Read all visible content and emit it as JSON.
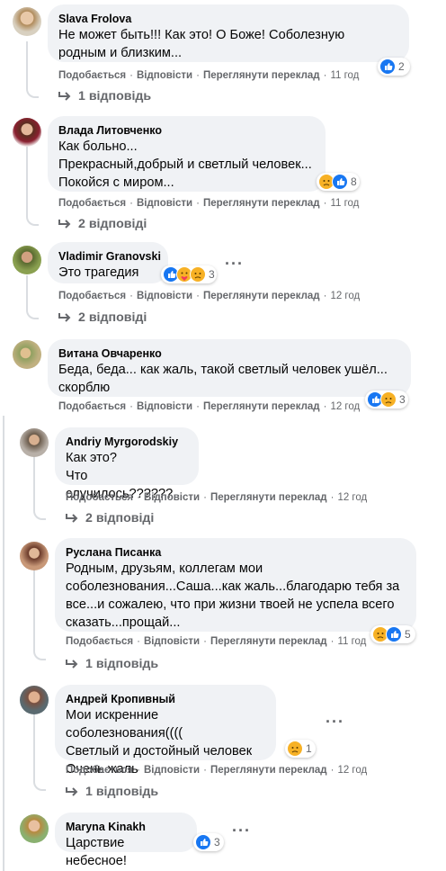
{
  "colors": {
    "like": "#1877f2",
    "sad": "#f7b125",
    "love": "#f33e58",
    "text_secondary": "#65676b",
    "bubble": "#f0f2f5"
  },
  "labels": {
    "like": "Подобається",
    "reply": "Відповісти",
    "translate": "Переглянути переклад"
  },
  "comments": [
    {
      "author": "Slava Frolova",
      "text": "Не может быть!!! Как это! О Боже! Соболезную\nродным и близким...",
      "time": "11 год",
      "reactions": [
        "like-icon"
      ],
      "react_count": "2",
      "replies": "1 відповідь"
    },
    {
      "author": "Влада Литовченко",
      "text": "Как больно...\nПрекрасный,добрый и светлый человек...\nПокойся с миром...",
      "time": "11 год",
      "reactions": [
        "sad-icon",
        "like-icon"
      ],
      "react_count": "8",
      "replies": "2 відповіді"
    },
    {
      "author": "Vladimir Granovski",
      "text": "Это трагедия",
      "time": "12 год",
      "reactions": [
        "like-icon",
        "care-icon",
        "sad-icon"
      ],
      "react_count": "3",
      "replies": "2 відповіді"
    },
    {
      "author": "Витана Овчаренко",
      "text": "Беда, беда... как жаль, такой светлый человек ушёл...\nскорблю",
      "time": "12 год",
      "reactions": [
        "like-icon",
        "sad-icon"
      ],
      "react_count": "3",
      "replies": ""
    },
    {
      "author": "Andriy Myrgorodskiy",
      "text": "Как это?\nЧто случилось??????",
      "time": "12 год",
      "reactions": [],
      "react_count": "",
      "replies": "2 відповіді"
    },
    {
      "author": "Руслана Писанка",
      "text": "Родным, друзьям, коллегам мои\nсоболезнования...Саша...как жаль...благодарю тебя за\nвсе...и сожалею, что при жизни твоей не успела всего\nсказать...прощай...",
      "time": "11 год",
      "reactions": [
        "sad-icon",
        "like-icon"
      ],
      "react_count": "5",
      "replies": "1 відповідь"
    },
    {
      "author": "Андрей Кропивный",
      "text": "Мои искренние соболезнования((((\nСветлый и достойный человек\nОчень жаль",
      "time": "12 год",
      "reactions": [
        "sad-icon"
      ],
      "react_count": "1",
      "replies": "1 відповідь"
    },
    {
      "author": "Maryna Kinakh",
      "text": "Царствие небесное!",
      "time": "",
      "reactions": [
        "like-icon"
      ],
      "react_count": "3",
      "replies": ""
    }
  ]
}
